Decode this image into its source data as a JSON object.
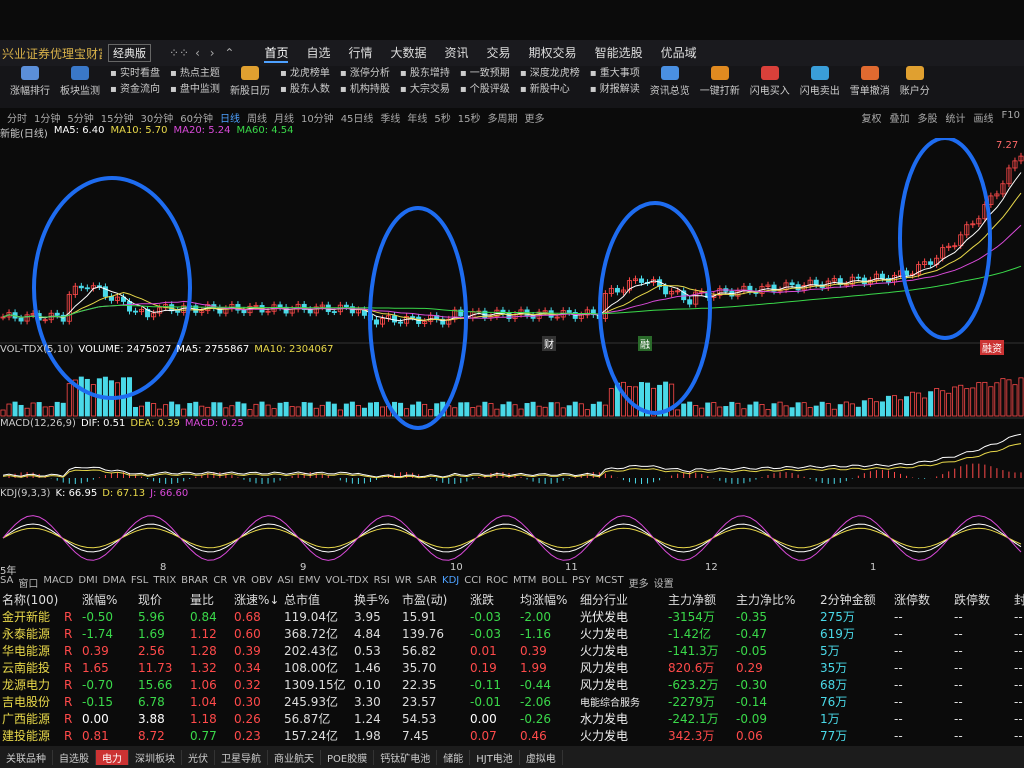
{
  "app": {
    "brand": "兴业证券优理宝财富版",
    "version": "经典版",
    "main_tabs": [
      "首页",
      "自选",
      "行情",
      "大数据",
      "资讯",
      "交易",
      "期权交易",
      "智能选股",
      "优品域"
    ],
    "active_tab": 0
  },
  "toolbar": {
    "big_items": [
      {
        "label": "涨幅排行",
        "color": "#5b8fd9"
      },
      {
        "label": "板块监测",
        "color": "#3a78c8"
      },
      {
        "label": "新股日历",
        "color": "#e0a030"
      },
      {
        "label": "资讯总览",
        "color": "#4a90e2"
      },
      {
        "label": "一键打新",
        "color": "#e08a20"
      },
      {
        "label": "闪电买入",
        "color": "#d9403a"
      },
      {
        "label": "闪电卖出",
        "color": "#3a9ed9"
      },
      {
        "label": "雪单撤消",
        "color": "#e06a30"
      },
      {
        "label": "账户分",
        "color": "#e0a030"
      }
    ],
    "pairs": [
      [
        "实时看盘",
        "资金流向"
      ],
      [
        "热点主题",
        "盘中监测"
      ],
      [
        "龙虎榜单",
        "股东人数"
      ],
      [
        "涨停分析",
        "机构持股"
      ],
      [
        "股东增持",
        "大宗交易"
      ],
      [
        "一致预期",
        "个股评级"
      ],
      [
        "深度龙虎榜",
        "新股中心"
      ],
      [
        "重大事项",
        "财报解读"
      ]
    ]
  },
  "periods": [
    "分时",
    "1分钟",
    "5分钟",
    "15分钟",
    "30分钟",
    "60分钟",
    "日线",
    "周线",
    "月线",
    "10分钟",
    "45日线",
    "季线",
    "年线",
    "5秒",
    "15秒",
    "多周期",
    "更多"
  ],
  "active_period": "日线",
  "right_tools": [
    "复权",
    "叠加",
    "多股",
    "统计",
    "画线",
    "F10"
  ],
  "ma": [
    {
      "label": "MA5: 6.40",
      "color": "#ffffff"
    },
    {
      "label": "MA10: 5.70",
      "color": "#e8d84a"
    },
    {
      "label": "MA20: 5.24",
      "color": "#d94ad9"
    },
    {
      "label": "MA60: 4.54",
      "color": "#3ad94a"
    }
  ],
  "ma_prefix": "新能(日线)",
  "price_label": "7.27",
  "annotations": {
    "cai": "财",
    "rong": "融",
    "mark_right": "融资"
  },
  "volume": {
    "label": "VOL-TDX(5,10)",
    "vol": "VOLUME: 2475027",
    "ma5": "MA5: 2755867",
    "ma10": "MA10: 2304067"
  },
  "macd": {
    "label": "MACD(12,26,9)",
    "dif": "DIF: 0.51",
    "dea": "DEA: 0.39",
    "macd": "MACD: 0.25"
  },
  "kdj": {
    "label": "KDJ(9,3,3)",
    "k": "K: 66.95",
    "d": "D: 67.13",
    "j": "J: 66.60"
  },
  "date_marks": [
    "5年",
    "8",
    "9",
    "10",
    "11",
    "12",
    "1"
  ],
  "indicator_tabs": [
    "SA",
    "窗口",
    "MACD",
    "DMI",
    "DMA",
    "FSL",
    "TRIX",
    "BRAR",
    "CR",
    "VR",
    "OBV",
    "ASI",
    "EMV",
    "VOL-TDX",
    "RSI",
    "WR",
    "SAR",
    "KDJ",
    "CCI",
    "ROC",
    "MTM",
    "BOLL",
    "PSY",
    "MCST",
    "更多",
    "设置"
  ],
  "active_indicator": "KDJ",
  "table": {
    "headers": [
      "名称(100)",
      "",
      "涨幅%",
      "现价",
      "量比",
      "涨速%↓",
      "总市值",
      "换手%",
      "市盈(动)",
      "涨跌",
      "均涨幅%",
      "细分行业",
      "主力净额",
      "主力净比%",
      "2分钟金额",
      "涨停数",
      "跌停数",
      "封单额"
    ],
    "rows": [
      [
        "金开新能",
        "R",
        "-0.50",
        "5.96",
        "0.84",
        "0.68",
        "119.04亿",
        "3.95",
        "15.91",
        "-0.03",
        "-2.00",
        "光伏发电",
        "-3154万",
        "-0.35",
        "275万",
        "--",
        "--",
        "--"
      ],
      [
        "永泰能源",
        "R",
        "-1.74",
        "1.69",
        "1.12",
        "0.60",
        "368.72亿",
        "4.84",
        "139.76",
        "-0.03",
        "-1.16",
        "火力发电",
        "-1.42亿",
        "-0.47",
        "619万",
        "--",
        "--",
        "--"
      ],
      [
        "华电能源",
        "R",
        "0.39",
        "2.56",
        "1.28",
        "0.39",
        "202.43亿",
        "0.53",
        "56.82",
        "0.01",
        "0.39",
        "火力发电",
        "-141.3万",
        "-0.05",
        "5万",
        "--",
        "--",
        "--"
      ],
      [
        "云南能投",
        "R",
        "1.65",
        "11.73",
        "1.32",
        "0.34",
        "108.00亿",
        "1.46",
        "35.70",
        "0.19",
        "1.99",
        "风力发电",
        "820.6万",
        "0.29",
        "35万",
        "--",
        "--",
        "--"
      ],
      [
        "龙源电力",
        "R",
        "-0.70",
        "15.66",
        "1.06",
        "0.32",
        "1309.15亿",
        "0.10",
        "22.35",
        "-0.11",
        "-0.44",
        "风力发电",
        "-623.2万",
        "-0.30",
        "68万",
        "--",
        "--",
        "--"
      ],
      [
        "吉电股份",
        "R",
        "-0.15",
        "6.78",
        "1.04",
        "0.30",
        "245.93亿",
        "3.30",
        "23.57",
        "-0.01",
        "-2.06",
        "电能综合服务",
        "-2279万",
        "-0.14",
        "76万",
        "--",
        "--",
        "--"
      ],
      [
        "广西能源",
        "R",
        "0.00",
        "3.88",
        "1.18",
        "0.26",
        "56.87亿",
        "1.24",
        "54.53",
        "0.00",
        "-0.26",
        "水力发电",
        "-242.1万",
        "-0.09",
        "1万",
        "--",
        "--",
        "--"
      ],
      [
        "建投能源",
        "R",
        "0.81",
        "8.72",
        "0.77",
        "0.23",
        "157.24亿",
        "1.98",
        "7.45",
        "0.07",
        "0.46",
        "火力发电",
        "342.3万",
        "0.06",
        "77万",
        "--",
        "--",
        "--"
      ]
    ]
  },
  "bottom_tabs": [
    "关联品种",
    "自选股",
    "电力",
    "深圳板块",
    "光伏",
    "卫星导航",
    "商业航天",
    "POE胶膜",
    "钙钛矿电池",
    "储能",
    "HJT电池",
    "虚拟电"
  ],
  "active_bottom_tab": "电力",
  "colors": {
    "up": "#ff4a4a",
    "down": "#3ad94a",
    "flat": "#ffffff",
    "cyan": "#4ad9e8",
    "yellow": "#e8d84a",
    "accent": "#4ea1ff"
  }
}
